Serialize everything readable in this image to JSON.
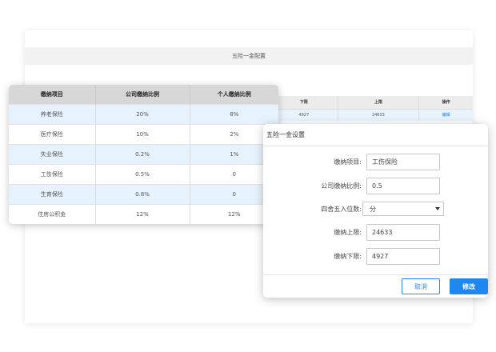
{
  "background_window": {
    "title": "五险一金配置",
    "table": {
      "headers": [
        "",
        "下限",
        "上限",
        "操作"
      ],
      "row": [
        "",
        "4927",
        "24633",
        "编辑"
      ]
    }
  },
  "rates_table": {
    "headers": [
      "缴纳项目",
      "公司缴纳比例",
      "个人缴纳比例"
    ],
    "rows": [
      [
        "养老保险",
        "20%",
        "8%"
      ],
      [
        "医疗保险",
        "10%",
        "2%"
      ],
      [
        "失业保险",
        "0.2%",
        "1%"
      ],
      [
        "工伤保险",
        "0.5%",
        "0"
      ],
      [
        "生育保险",
        "0.8%",
        "0"
      ],
      [
        "住房公积金",
        "12%",
        "12%"
      ]
    ]
  },
  "dialog": {
    "title": "五险一金设置",
    "fields": {
      "item_label": "缴纳项目:",
      "item_value": "工伤保险",
      "company_ratio_label": "公司缴纳比例:",
      "company_ratio_value": "0.5",
      "rounding_label": "四舍五入位数:",
      "rounding_value": "分",
      "upper_label": "缴纳上限:",
      "upper_value": "24633",
      "lower_label": "缴纳下限:",
      "lower_value": "4927"
    },
    "cancel_label": "取消",
    "confirm_label": "修改"
  },
  "colors": {
    "accent": "#1e88f0",
    "row_highlight": "#e6f2fd",
    "header_gray": "#d7d7d7"
  },
  "icons": {
    "select_arrow": "chevron-down-icon"
  }
}
